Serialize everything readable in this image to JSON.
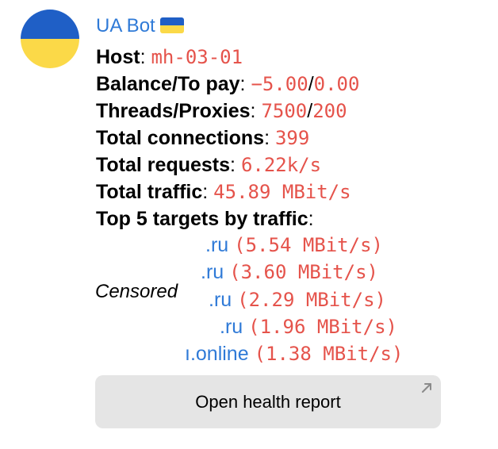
{
  "sender": {
    "name": "UA Bot",
    "flag_icon": "ukraine-flag-icon"
  },
  "avatar": {
    "colors": [
      "#1f5fc6",
      "#fbd948"
    ]
  },
  "stats": {
    "host": {
      "label": "Host",
      "value": "mh-03-01"
    },
    "balance": {
      "label": "Balance/To pay",
      "value1": "−5.00",
      "sep": "/",
      "value2": "0.00"
    },
    "threads": {
      "label": "Threads/Proxies",
      "value1": "7500",
      "sep": "/",
      "value2": "200"
    },
    "connections": {
      "label": "Total connections",
      "value": "399"
    },
    "requests": {
      "label": "Total requests",
      "value": "6.22k/s"
    },
    "traffic": {
      "label": "Total traffic",
      "value": "45.89 MBit/s"
    },
    "top_targets_label": "Top 5 targets by traffic"
  },
  "targets": [
    {
      "domain": ".ru",
      "rate": "(5.54 MBit/s)"
    },
    {
      "domain": ".ru",
      "rate": "(3.60 MBit/s)"
    },
    {
      "domain": ".ru",
      "rate": "(2.29 MBit/s)"
    },
    {
      "domain": ".ru",
      "rate": "(1.96 MBit/s)"
    },
    {
      "domain": "ı.online",
      "rate": "(1.38 MBit/s)"
    }
  ],
  "censored_label": "Censored",
  "button": {
    "label": "Open health report",
    "icon": "external-link-arrow-icon"
  },
  "colors": {
    "link": "#2f7ad7",
    "code": "#e5534b",
    "button_bg": "#e5e5e5"
  }
}
